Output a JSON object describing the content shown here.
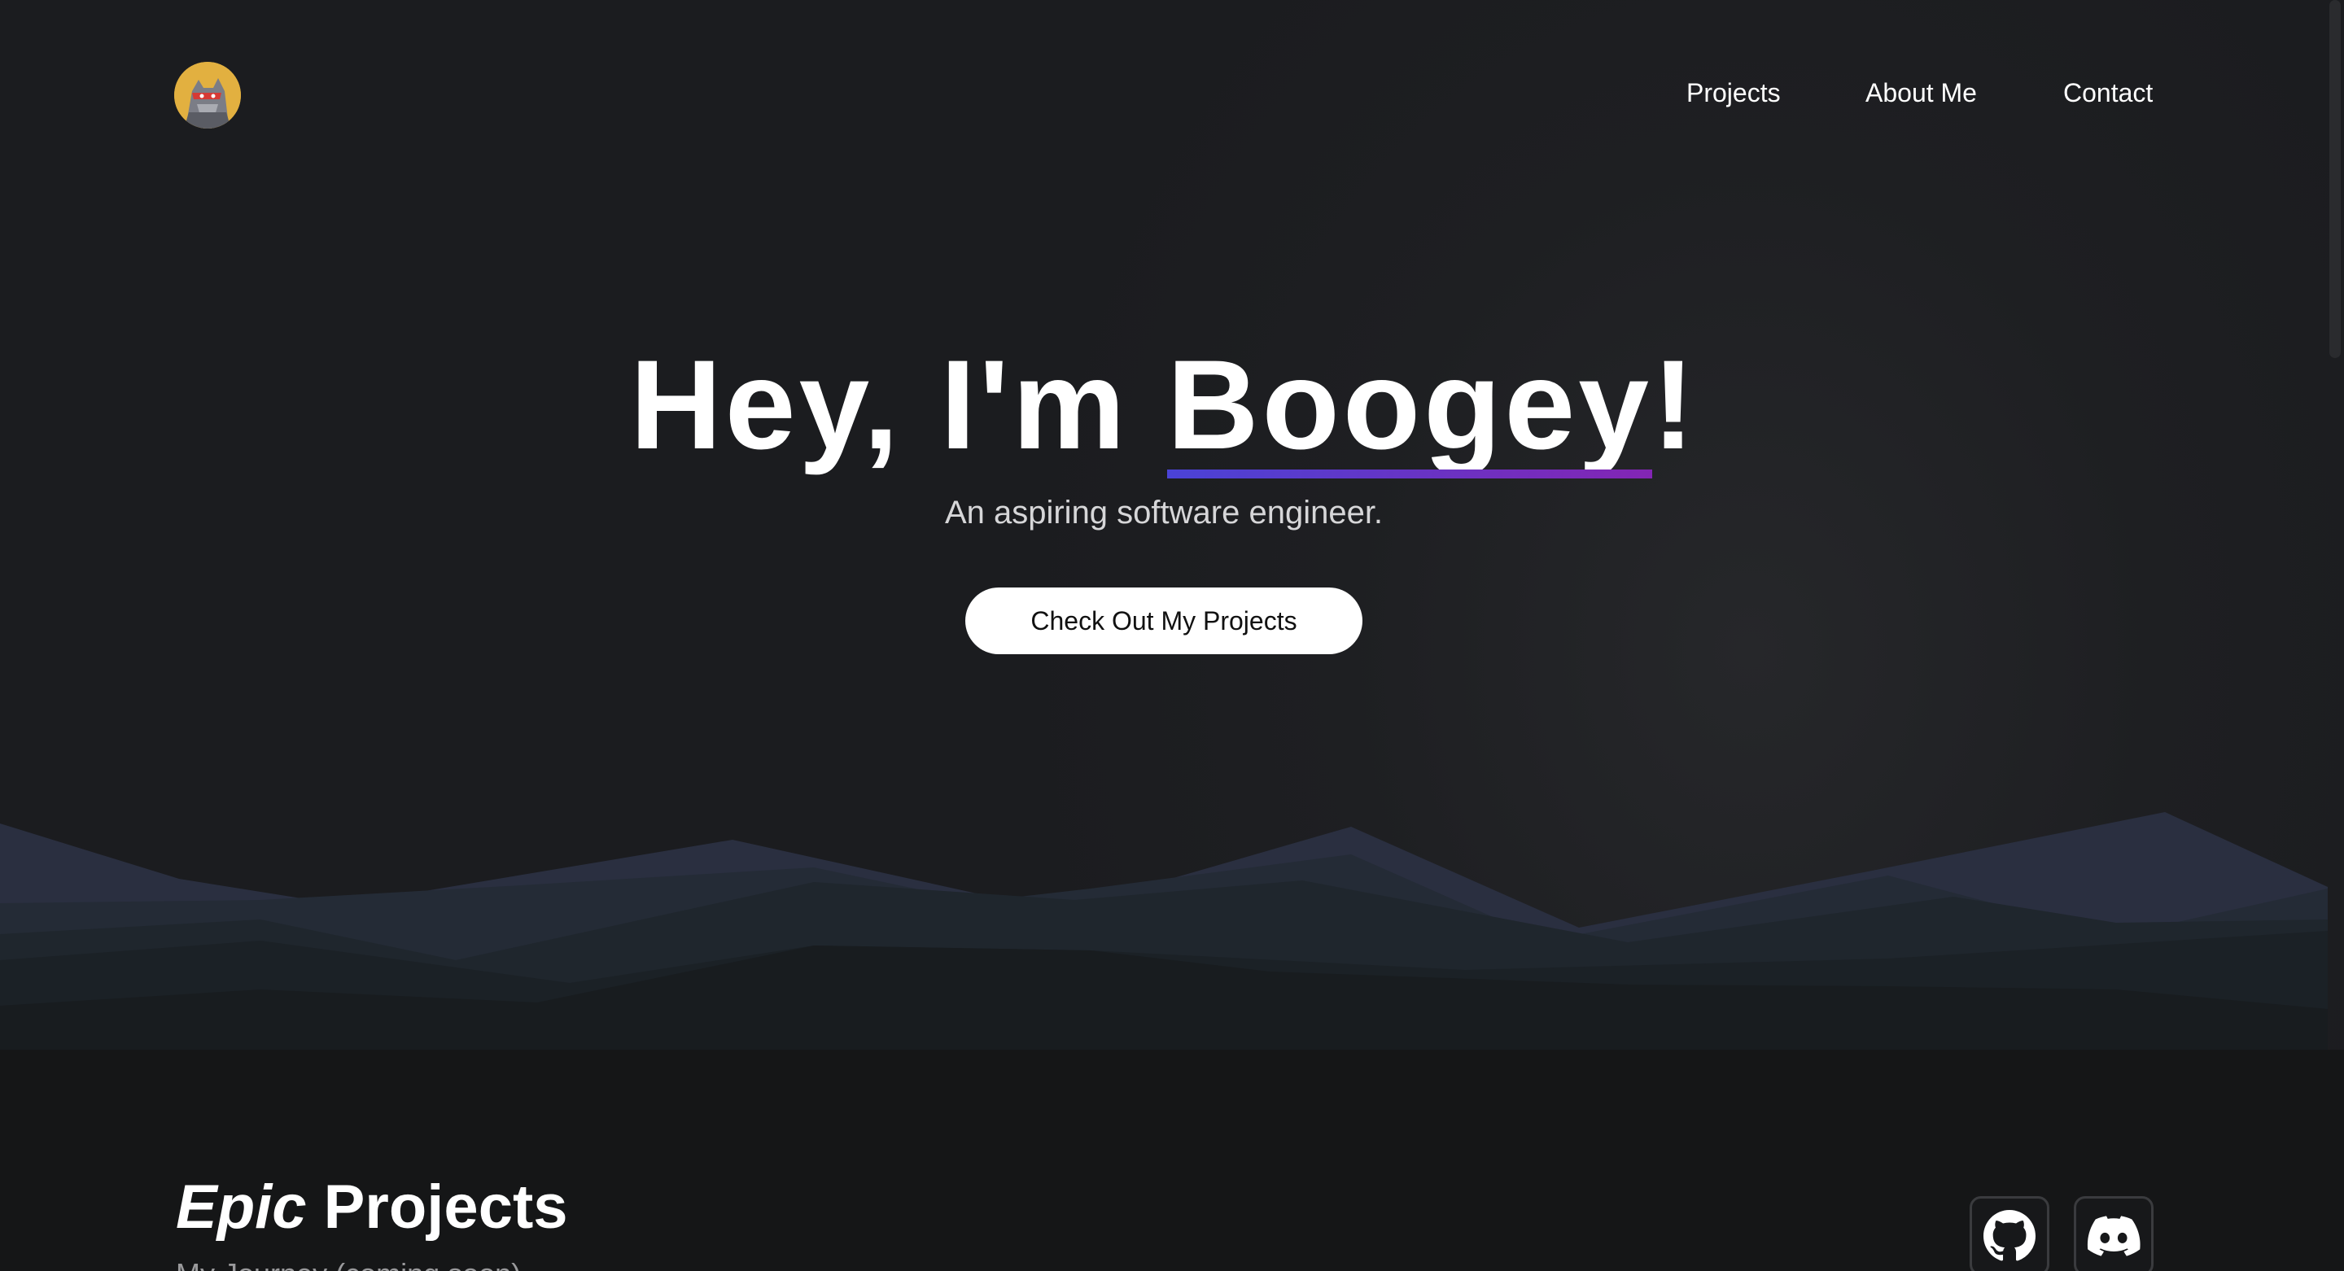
{
  "nav": {
    "avatar_alt": "Boogey avatar",
    "links": [
      "Projects",
      "About Me",
      "Contact"
    ]
  },
  "hero": {
    "greeting": "Hey, I'm ",
    "name": "Boogey",
    "exclaim": "!",
    "subtitle": "An aspiring software engineer.",
    "cta_label": "Check Out My Projects"
  },
  "projects": {
    "heading_em": "Epic",
    "heading_rest": " Projects",
    "subtitle": "My Journey (coming soon)"
  },
  "social": {
    "items": [
      {
        "name": "github",
        "icon": "github-icon"
      },
      {
        "name": "discord",
        "icon": "discord-icon"
      }
    ]
  },
  "colors": {
    "background": "#1b1c1f",
    "underline_start": "#4a43d6",
    "underline_end": "#8325b4",
    "avatar_bg": "#e2b040",
    "button_bg": "#ffffff"
  }
}
